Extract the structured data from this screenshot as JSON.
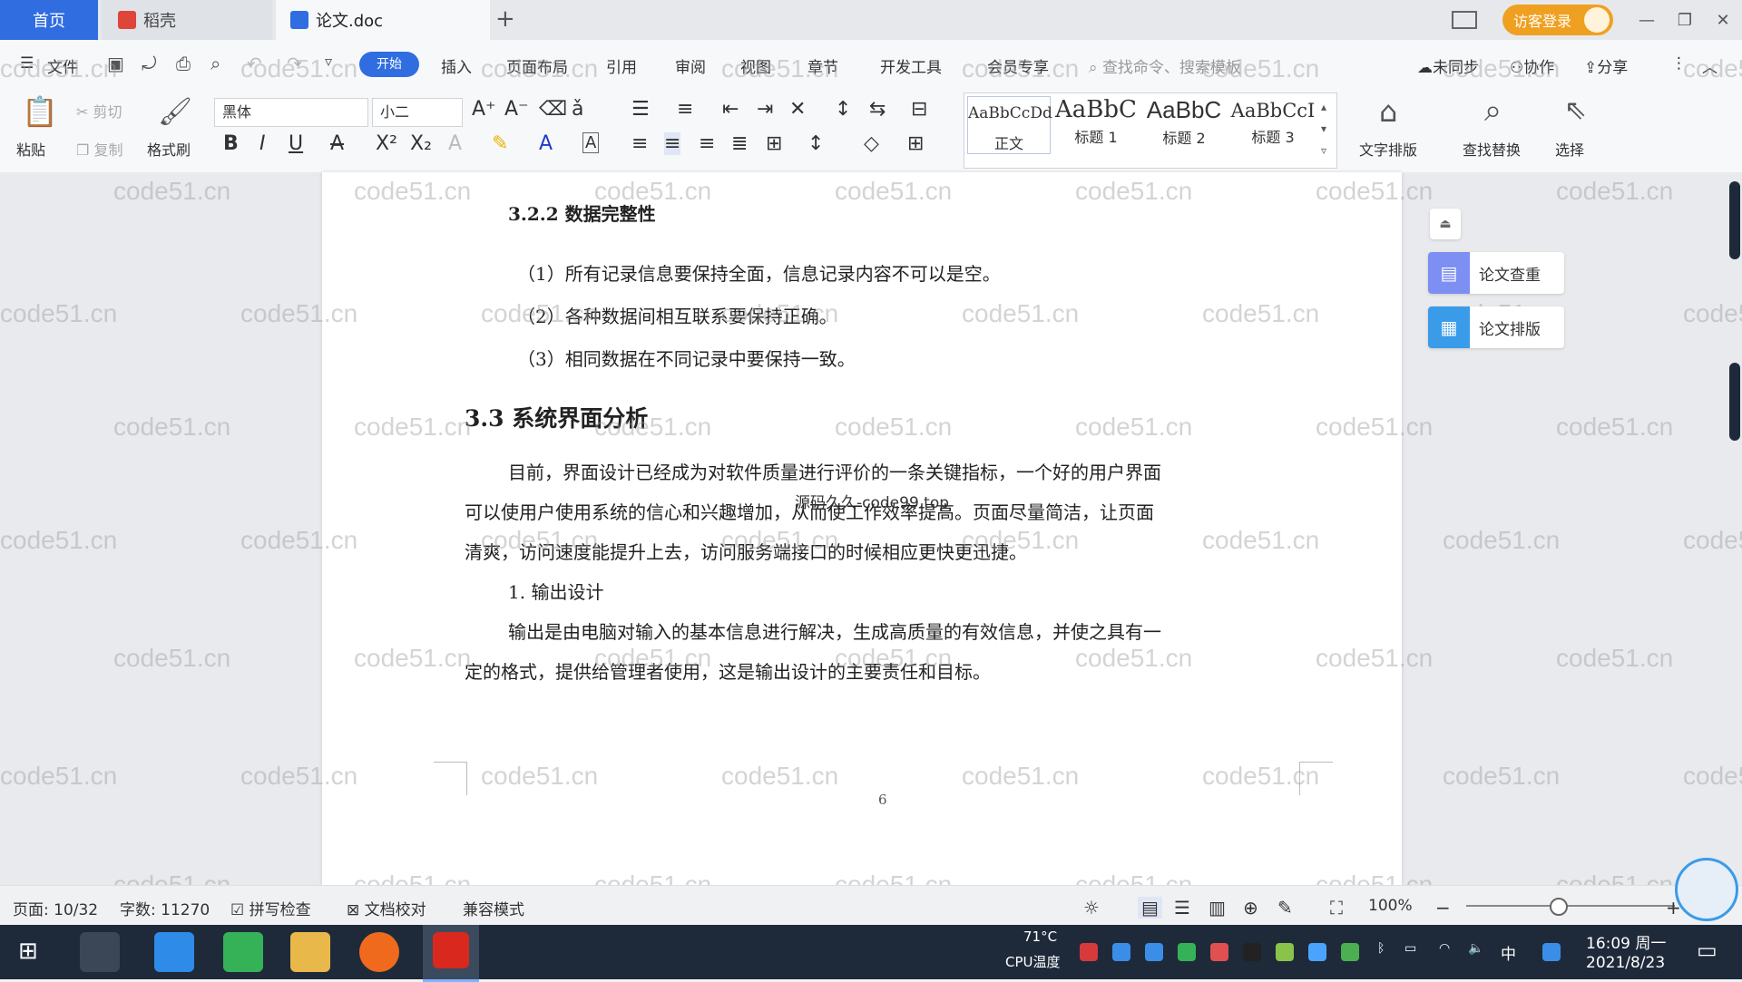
{
  "tabs": {
    "home": "首页",
    "daoke": "稻壳",
    "doc": "论文.doc",
    "add": "+"
  },
  "titlebar": {
    "visitor_login": "访客登录"
  },
  "menu": {
    "file": "文件",
    "start": "开始",
    "insert": "插入",
    "page_layout": "页面布局",
    "reference": "引用",
    "review": "审阅",
    "view": "视图",
    "chapter": "章节",
    "dev_tools": "开发工具",
    "member": "会员专享",
    "search_cmd": "查找命令、搜索模板",
    "unsynced": "未同步",
    "collaborate": "协作",
    "share": "分享"
  },
  "ribbon": {
    "paste": "粘贴",
    "cut": "剪切",
    "copy": "复制",
    "format_painter": "格式刷",
    "font": "黑体",
    "size": "小二",
    "styles": [
      {
        "preview": "AaBbCcDd",
        "label": "正文"
      },
      {
        "preview": "AaBbC",
        "label": "标题 1"
      },
      {
        "preview": "AaBbC",
        "label": "标题 2"
      },
      {
        "preview": "AaBbCcI",
        "label": "标题 3"
      }
    ],
    "text_layout": "文字排版",
    "find_replace": "查找替换",
    "select": "选择"
  },
  "document": {
    "h322": "3.2.2  数据完整性",
    "items": [
      "（1）所有记录信息要保持全面，信息记录内容不可以是空。",
      "（2）各种数据间相互联系要保持正确。",
      "（3）相同数据在不同记录中要保持一致。"
    ],
    "h33": "3.3 系统界面分析",
    "para1_line1": "目前，界面设计已经成为对软件质量进行评价的一条关键指标，一个好的用户界面",
    "para1_line2": "可以使用户使用系统的信心和兴趣增加，从而使工作效率提高。页面尽量简洁，让页面",
    "para1_line3": "清爽，访问速度能提升上去，访问服务端接口的时候相应更快更迅捷。",
    "sub1": "1. 输出设计",
    "para2_line1": "输出是由电脑对输入的基本信息进行解决，生成高质量的有效信息，并使之具有一",
    "para2_line2": "定的格式，提供给管理者使用，这是输出设计的主要责任和目标。",
    "page_number": "6",
    "center_watermark": "源码久久-code99.top",
    "watermark": "code51.cn"
  },
  "side_panel": {
    "check": "论文查重",
    "layout": "论文排版"
  },
  "status": {
    "page": "页面: 10/32",
    "words": "字数: 11270",
    "spell": "拼写检查",
    "proofread": "文档校对",
    "compat": "兼容模式",
    "zoom": "100%"
  },
  "taskbar": {
    "temp": "71°C",
    "cpu": "CPU温度",
    "ime": "中",
    "time": "16:09 周一",
    "date": "2021/8/23"
  },
  "colors": {
    "accent": "#2f6de1",
    "visitor": "#f0a020"
  }
}
